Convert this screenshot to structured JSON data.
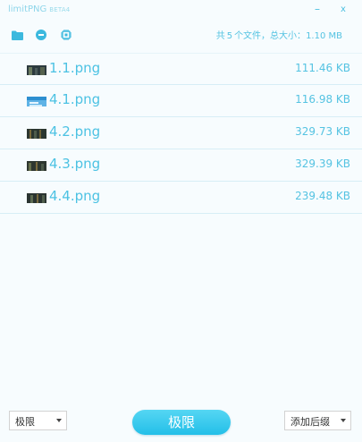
{
  "window": {
    "title": "limitPNG",
    "badge": "BETA4",
    "minimize_glyph": "–",
    "close_glyph": "x"
  },
  "toolbar": {
    "icons": [
      "folder-icon",
      "minus-circle-icon",
      "chip-icon"
    ],
    "summary": {
      "prefix": "共",
      "count": "5",
      "middle": "个文件，总大小：",
      "total_size": "1.10 MB"
    }
  },
  "files": [
    {
      "name": "1.1.png",
      "size": "111.46 KB"
    },
    {
      "name": "4.1.png",
      "size": "116.98 KB"
    },
    {
      "name": "4.2.png",
      "size": "329.73 KB"
    },
    {
      "name": "4.3.png",
      "size": "329.39 KB"
    },
    {
      "name": "4.4.png",
      "size": "239.48 KB"
    }
  ],
  "bottom": {
    "mode_select": "极限",
    "primary_button": "极限",
    "suffix_select": "添加后缀"
  },
  "colors": {
    "accent": "#23bfe8",
    "text_accent": "#4cc2e3",
    "background": "#f7fcfe"
  }
}
